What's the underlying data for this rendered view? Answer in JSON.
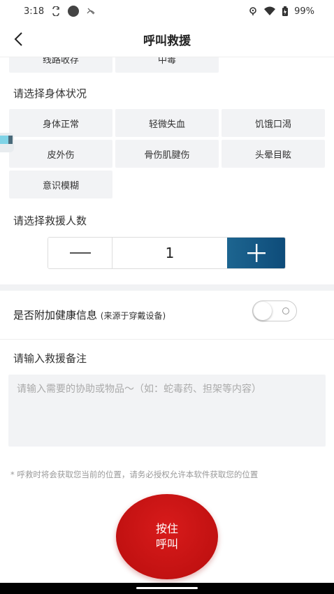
{
  "status_bar": {
    "time": "3:18",
    "battery": "99%"
  },
  "header": {
    "title": "呼叫救援"
  },
  "top_chips": [
    {
      "label": "线路收存"
    },
    {
      "label": "中毒"
    }
  ],
  "body_status": {
    "label": "请选择身体状况",
    "options": [
      "身体正常",
      "轻微失血",
      "饥饿口渴",
      "皮外伤",
      "骨伤肌腱伤",
      "头晕目眩",
      "意识模糊"
    ]
  },
  "rescue_count": {
    "label": "请选择救援人数",
    "value": "1",
    "decrement": "—",
    "increment": "+"
  },
  "health_info": {
    "label": "是否附加健康信息",
    "sub": "(来源于穿戴设备)",
    "enabled": false
  },
  "remark": {
    "label": "请输入救援备注",
    "value": "",
    "placeholder": "请输入需要的协助或物品～（如：蛇毒药、担架等内容）"
  },
  "notice": "* 呼救时将会获取您当前的位置，请务必授权允许本软件获取您的位置",
  "call_button": {
    "line1": "按住",
    "line2": "呼叫"
  },
  "colors": {
    "accent": "#0e4c7a",
    "danger": "#c8101a",
    "chip_bg": "#f2f3f5"
  }
}
